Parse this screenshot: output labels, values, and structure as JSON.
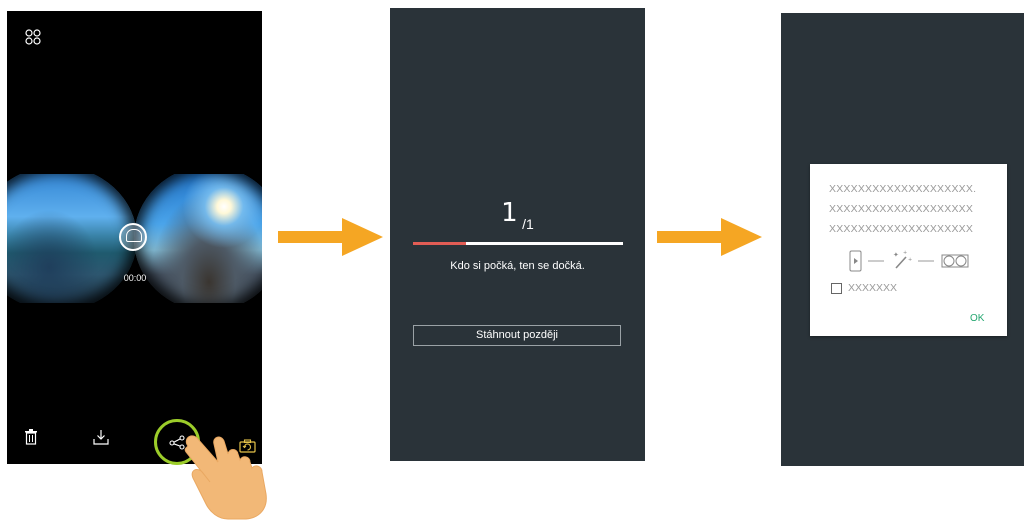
{
  "panel1": {
    "time": "00:00",
    "icons": [
      "grid-icon",
      "trash-icon",
      "download-icon",
      "share-icon",
      "camera-switch-icon",
      "vr-view-icon"
    ],
    "share_ring_color": "#9ccd2a"
  },
  "panel2": {
    "counter_current": "1",
    "counter_total": "/1",
    "progress": 0.25,
    "progress_fill_color": "#e25d55",
    "wait_text": "Kdo si počká, ten se dočká.",
    "later_button": "Stáhnout později"
  },
  "panel3": {
    "line1": "XXXXXXXXXXXXXXXXXXXX.",
    "line2": "XXXXXXXXXXXXXXXXXXXX",
    "line3": "XXXXXXXXXXXXXXXXXXXX",
    "checkbox_label": "XXXXXXX",
    "ok_button": "OK",
    "ok_color": "#23a66f"
  },
  "colors": {
    "arrow": "#f5a623",
    "panel_bg": "#2a3339"
  }
}
